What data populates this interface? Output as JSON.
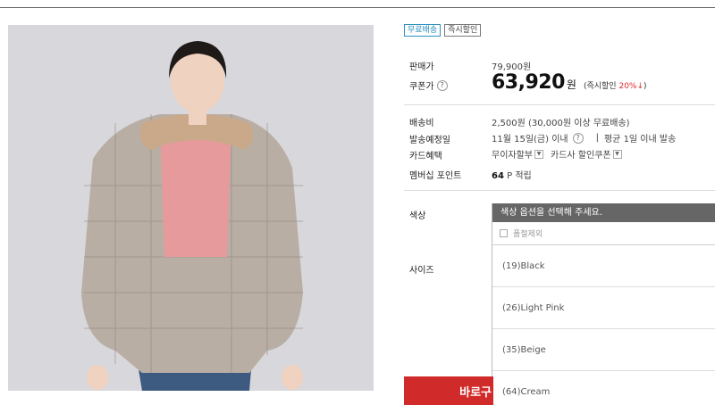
{
  "badges": {
    "free_shipping": "무료배송",
    "instant_discount": "즉시할인"
  },
  "price": {
    "sale_label": "판매가",
    "sale_value": "79,900원",
    "coupon_label": "쿠폰가",
    "coupon_value": "63,920",
    "coupon_unit": "원",
    "discount_prefix": "(즉시할인",
    "discount_rate": "20%↓",
    "discount_suffix": ")"
  },
  "shipping": {
    "fee_label": "배송비",
    "fee_value": "2,500원 (30,000원 이상 무료배송)",
    "eta_label": "발송예정일",
    "eta_value": "11월 15일(금) 이내",
    "eta_avg": "평균 1일 이내 발송",
    "card_label": "카드혜택",
    "card_installment": "무이자할부",
    "card_coupon": "카드사 할인쿠폰",
    "points_label": "멤버십 포인트",
    "points_value": "64",
    "points_unit": "P 적립"
  },
  "options": {
    "color_label": "색상",
    "size_label": "사이즈",
    "placeholder": "색상 옵션을 선택해 주세요.",
    "exclude_soldout": "품절제외",
    "items": [
      "(19)Black",
      "(26)Light Pink",
      "(35)Beige",
      "(64)Cream"
    ]
  },
  "actions": {
    "buy_now": "바로구"
  },
  "icons": {
    "help": "question-circle-icon",
    "select": "chevron-down-icon"
  },
  "colors": {
    "accent_red": "#d12a2a",
    "discount_red": "#e0262a",
    "badge_blue": "#2a8fbf",
    "dropdown_header": "#666666"
  }
}
